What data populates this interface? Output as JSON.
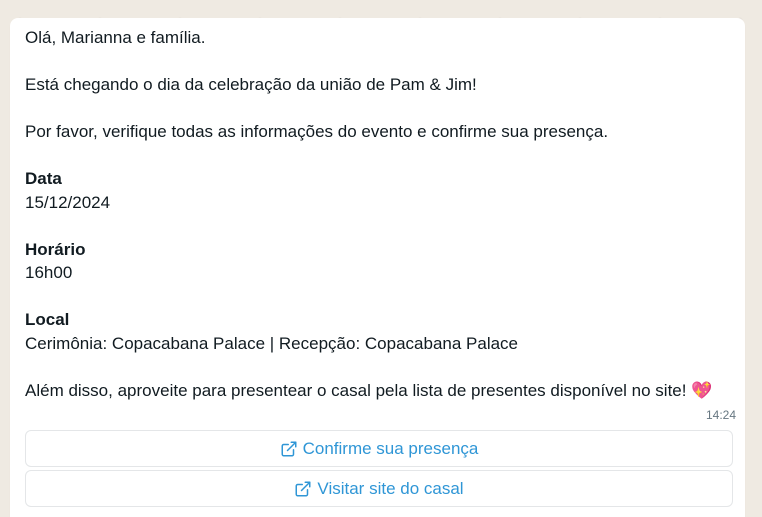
{
  "message": {
    "greeting": "Olá, Marianna e família.",
    "line_announcement": "Está chegando o dia da celebração da união de Pam & Jim!",
    "line_request": "Por favor, verifique todas as informações do evento e confirme sua presença.",
    "date_label": "Data",
    "date_value": "15/12/2024",
    "time_label": "Horário",
    "time_value": "16h00",
    "place_label": "Local",
    "place_value": "Cerimônia: Copacabana Palace | Recepção: Copacabana Palace",
    "closing": "Além disso, aproveite para presentear o casal pela lista de presentes disponível no site!",
    "closing_emoji": "💖",
    "timestamp": "14:24"
  },
  "buttons": {
    "confirm_label": "Confirme sua presença",
    "site_label": "Visitar site do casal",
    "icon": "external-link-icon"
  },
  "colors": {
    "background": "#efeae2",
    "bubble": "#ffffff",
    "text": "#111b21",
    "link": "#2f96d6",
    "timestamp": "#667781"
  }
}
